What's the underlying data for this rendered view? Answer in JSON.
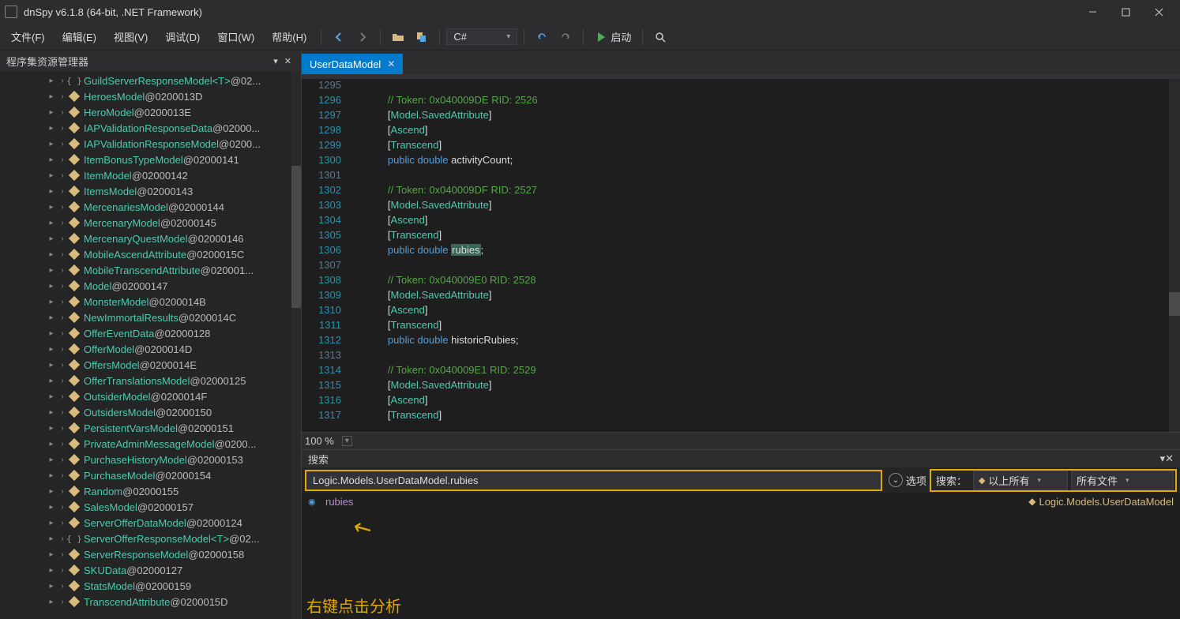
{
  "app": {
    "title": "dnSpy v6.1.8 (64-bit, .NET Framework)"
  },
  "menu": {
    "file": "文件(F)",
    "edit": "编辑(E)",
    "view": "视图(V)",
    "debug": "调试(D)",
    "window": "窗口(W)",
    "help": "帮助(H)",
    "language": "C#",
    "run": "启动"
  },
  "sidebar": {
    "title": "程序集资源管理器",
    "items": [
      {
        "kind": "brack",
        "name": "GuildServerResponseModel",
        "generic": "<T>",
        "suffix": " @02..."
      },
      {
        "kind": "struct",
        "name": "HeroesModel",
        "suffix": " @0200013D"
      },
      {
        "kind": "struct",
        "name": "HeroModel",
        "suffix": " @0200013E"
      },
      {
        "kind": "struct",
        "name": "IAPValidationResponseData",
        "suffix": " @02000..."
      },
      {
        "kind": "struct",
        "name": "IAPValidationResponseModel",
        "suffix": " @0200..."
      },
      {
        "kind": "struct",
        "name": "ItemBonusTypeModel",
        "suffix": " @02000141"
      },
      {
        "kind": "struct",
        "name": "ItemModel",
        "suffix": " @02000142"
      },
      {
        "kind": "struct",
        "name": "ItemsModel",
        "suffix": " @02000143"
      },
      {
        "kind": "struct",
        "name": "MercenariesModel",
        "suffix": " @02000144"
      },
      {
        "kind": "struct",
        "name": "MercenaryModel",
        "suffix": " @02000145"
      },
      {
        "kind": "struct",
        "name": "MercenaryQuestModel",
        "suffix": " @02000146"
      },
      {
        "kind": "struct",
        "name": "MobileAscendAttribute",
        "suffix": " @0200015C"
      },
      {
        "kind": "struct",
        "name": "MobileTranscendAttribute",
        "suffix": " @020001..."
      },
      {
        "kind": "struct",
        "name": "Model",
        "suffix": " @02000147"
      },
      {
        "kind": "struct",
        "name": "MonsterModel",
        "suffix": " @0200014B"
      },
      {
        "kind": "struct",
        "name": "NewImmortalResults",
        "suffix": " @0200014C"
      },
      {
        "kind": "struct",
        "name": "OfferEventData",
        "suffix": " @02000128"
      },
      {
        "kind": "struct",
        "name": "OfferModel",
        "suffix": " @0200014D"
      },
      {
        "kind": "struct",
        "name": "OffersModel",
        "suffix": " @0200014E"
      },
      {
        "kind": "struct",
        "name": "OfferTranslationsModel",
        "suffix": " @02000125"
      },
      {
        "kind": "struct",
        "name": "OutsiderModel",
        "suffix": " @0200014F"
      },
      {
        "kind": "struct",
        "name": "OutsidersModel",
        "suffix": " @02000150"
      },
      {
        "kind": "struct",
        "name": "PersistentVarsModel",
        "suffix": " @02000151"
      },
      {
        "kind": "struct",
        "name": "PrivateAdminMessageModel",
        "suffix": " @0200..."
      },
      {
        "kind": "struct",
        "name": "PurchaseHistoryModel",
        "suffix": " @02000153"
      },
      {
        "kind": "struct",
        "name": "PurchaseModel",
        "suffix": " @02000154"
      },
      {
        "kind": "struct",
        "name": "Random",
        "suffix": " @02000155"
      },
      {
        "kind": "struct",
        "name": "SalesModel",
        "suffix": " @02000157"
      },
      {
        "kind": "struct",
        "name": "ServerOfferDataModel",
        "suffix": " @02000124"
      },
      {
        "kind": "brack",
        "name": "ServerOfferResponseModel",
        "generic": "<T>",
        "suffix": " @02..."
      },
      {
        "kind": "struct",
        "name": "ServerResponseModel",
        "suffix": " @02000158"
      },
      {
        "kind": "struct",
        "name": "SKUData",
        "suffix": " @02000127"
      },
      {
        "kind": "struct",
        "name": "StatsModel",
        "suffix": " @02000159"
      },
      {
        "kind": "struct",
        "name": "TranscendAttribute",
        "suffix": " @0200015D"
      }
    ]
  },
  "tab": {
    "name": "UserDataModel"
  },
  "code": [
    {
      "n": "1295",
      "dim": true,
      "seg": []
    },
    {
      "n": "1296",
      "seg": [
        {
          "t": "        ",
          "c": ""
        },
        {
          "t": "// Token: 0x040009DE RID: 2526",
          "c": "cm-comment"
        }
      ]
    },
    {
      "n": "1297",
      "seg": [
        {
          "t": "        ",
          "c": ""
        },
        {
          "t": "[",
          "c": "cm-punct"
        },
        {
          "t": "Model",
          "c": "cm-attr"
        },
        {
          "t": ".",
          "c": "cm-punct"
        },
        {
          "t": "SavedAttribute",
          "c": "cm-attr"
        },
        {
          "t": "]",
          "c": "cm-punct"
        }
      ]
    },
    {
      "n": "1298",
      "seg": [
        {
          "t": "        ",
          "c": ""
        },
        {
          "t": "[",
          "c": "cm-punct"
        },
        {
          "t": "Ascend",
          "c": "cm-attr"
        },
        {
          "t": "]",
          "c": "cm-punct"
        }
      ]
    },
    {
      "n": "1299",
      "seg": [
        {
          "t": "        ",
          "c": ""
        },
        {
          "t": "[",
          "c": "cm-punct"
        },
        {
          "t": "Transcend",
          "c": "cm-attr"
        },
        {
          "t": "]",
          "c": "cm-punct"
        }
      ]
    },
    {
      "n": "1300",
      "seg": [
        {
          "t": "        ",
          "c": ""
        },
        {
          "t": "public",
          "c": "cm-kw"
        },
        {
          "t": " ",
          "c": ""
        },
        {
          "t": "double",
          "c": "cm-kw"
        },
        {
          "t": " ",
          "c": ""
        },
        {
          "t": "activityCount",
          "c": "cm-id"
        },
        {
          "t": ";",
          "c": "cm-punct"
        }
      ]
    },
    {
      "n": "1301",
      "dim": true,
      "seg": []
    },
    {
      "n": "1302",
      "seg": [
        {
          "t": "        ",
          "c": ""
        },
        {
          "t": "// Token: 0x040009DF RID: 2527",
          "c": "cm-comment"
        }
      ]
    },
    {
      "n": "1303",
      "seg": [
        {
          "t": "        ",
          "c": ""
        },
        {
          "t": "[",
          "c": "cm-punct"
        },
        {
          "t": "Model",
          "c": "cm-attr"
        },
        {
          "t": ".",
          "c": "cm-punct"
        },
        {
          "t": "SavedAttribute",
          "c": "cm-attr"
        },
        {
          "t": "]",
          "c": "cm-punct"
        }
      ]
    },
    {
      "n": "1304",
      "seg": [
        {
          "t": "        ",
          "c": ""
        },
        {
          "t": "[",
          "c": "cm-punct"
        },
        {
          "t": "Ascend",
          "c": "cm-attr"
        },
        {
          "t": "]",
          "c": "cm-punct"
        }
      ]
    },
    {
      "n": "1305",
      "seg": [
        {
          "t": "        ",
          "c": ""
        },
        {
          "t": "[",
          "c": "cm-punct"
        },
        {
          "t": "Transcend",
          "c": "cm-attr"
        },
        {
          "t": "]",
          "c": "cm-punct"
        }
      ]
    },
    {
      "n": "1306",
      "seg": [
        {
          "t": "        ",
          "c": ""
        },
        {
          "t": "public",
          "c": "cm-kw"
        },
        {
          "t": " ",
          "c": ""
        },
        {
          "t": "double",
          "c": "cm-kw"
        },
        {
          "t": " ",
          "c": ""
        },
        {
          "t": "rubies",
          "c": "cm-id",
          "hl": true
        },
        {
          "t": ";",
          "c": "cm-punct"
        }
      ]
    },
    {
      "n": "1307",
      "dim": true,
      "seg": []
    },
    {
      "n": "1308",
      "seg": [
        {
          "t": "        ",
          "c": ""
        },
        {
          "t": "// Token: 0x040009E0 RID: 2528",
          "c": "cm-comment"
        }
      ]
    },
    {
      "n": "1309",
      "seg": [
        {
          "t": "        ",
          "c": ""
        },
        {
          "t": "[",
          "c": "cm-punct"
        },
        {
          "t": "Model",
          "c": "cm-attr"
        },
        {
          "t": ".",
          "c": "cm-punct"
        },
        {
          "t": "SavedAttribute",
          "c": "cm-attr"
        },
        {
          "t": "]",
          "c": "cm-punct"
        }
      ]
    },
    {
      "n": "1310",
      "seg": [
        {
          "t": "        ",
          "c": ""
        },
        {
          "t": "[",
          "c": "cm-punct"
        },
        {
          "t": "Ascend",
          "c": "cm-attr"
        },
        {
          "t": "]",
          "c": "cm-punct"
        }
      ]
    },
    {
      "n": "1311",
      "seg": [
        {
          "t": "        ",
          "c": ""
        },
        {
          "t": "[",
          "c": "cm-punct"
        },
        {
          "t": "Transcend",
          "c": "cm-attr"
        },
        {
          "t": "]",
          "c": "cm-punct"
        }
      ]
    },
    {
      "n": "1312",
      "seg": [
        {
          "t": "        ",
          "c": ""
        },
        {
          "t": "public",
          "c": "cm-kw"
        },
        {
          "t": " ",
          "c": ""
        },
        {
          "t": "double",
          "c": "cm-kw"
        },
        {
          "t": " ",
          "c": ""
        },
        {
          "t": "historicRubies",
          "c": "cm-id"
        },
        {
          "t": ";",
          "c": "cm-punct"
        }
      ]
    },
    {
      "n": "1313",
      "dim": true,
      "seg": []
    },
    {
      "n": "1314",
      "seg": [
        {
          "t": "        ",
          "c": ""
        },
        {
          "t": "// Token: 0x040009E1 RID: 2529",
          "c": "cm-comment"
        }
      ]
    },
    {
      "n": "1315",
      "seg": [
        {
          "t": "        ",
          "c": ""
        },
        {
          "t": "[",
          "c": "cm-punct"
        },
        {
          "t": "Model",
          "c": "cm-attr"
        },
        {
          "t": ".",
          "c": "cm-punct"
        },
        {
          "t": "SavedAttribute",
          "c": "cm-attr"
        },
        {
          "t": "]",
          "c": "cm-punct"
        }
      ]
    },
    {
      "n": "1316",
      "seg": [
        {
          "t": "        ",
          "c": ""
        },
        {
          "t": "[",
          "c": "cm-punct"
        },
        {
          "t": "Ascend",
          "c": "cm-attr"
        },
        {
          "t": "]",
          "c": "cm-punct"
        }
      ]
    },
    {
      "n": "1317",
      "seg": [
        {
          "t": "        ",
          "c": ""
        },
        {
          "t": "[",
          "c": "cm-punct"
        },
        {
          "t": "Transcend",
          "c": "cm-attr"
        },
        {
          "t": "]",
          "c": "cm-punct"
        }
      ]
    }
  ],
  "zoom": {
    "level": "100 %"
  },
  "search": {
    "title": "搜索",
    "input": "Logic.Models.UserDataModel.rubies",
    "optionsLabel": "选项",
    "scopeLabel": "搜索：",
    "scope1": "以上所有",
    "scope2": "所有文件",
    "result": {
      "name": "rubies",
      "path": "Logic.Models.UserDataModel"
    },
    "annotation": "右键点击分析"
  }
}
